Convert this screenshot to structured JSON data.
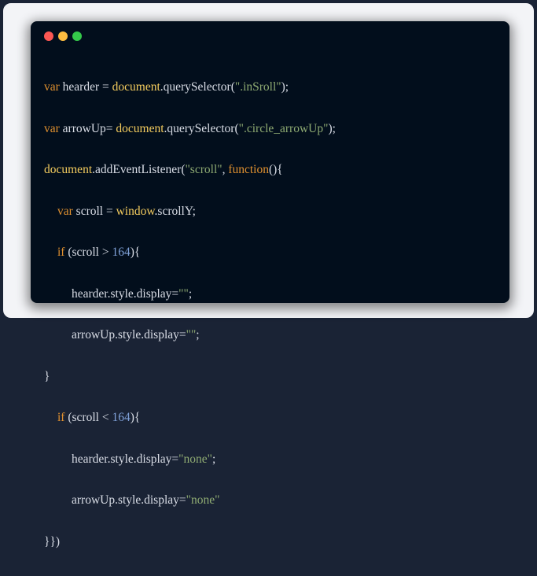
{
  "window": {
    "controls": [
      {
        "name": "close",
        "color": "#fc5753"
      },
      {
        "name": "minimize",
        "color": "#fdbc40"
      },
      {
        "name": "maximize",
        "color": "#34c84a"
      }
    ]
  },
  "colors": {
    "background": "#020e1c",
    "text": "#d9dde6",
    "keyword": "#e0902f",
    "object": "#f4cc5e",
    "string": "#8eaa72",
    "number": "#7fa1d8"
  },
  "code": {
    "line1": {
      "kw": "var",
      "a": " hearder = ",
      "obj": "document",
      "b": ".querySelector(",
      "str": "\".inSroll\"",
      "c": ");"
    },
    "line2": {
      "kw": "var",
      "a": " arrowUp= ",
      "obj": "document",
      "b": ".querySelector(",
      "str": "\".circle_arrowUp\"",
      "c": ");"
    },
    "line3": {
      "obj": "document",
      "a": ".addEventListener(",
      "str": "\"scroll\"",
      "b": ", ",
      "kw": "function",
      "c": "(){"
    },
    "line4": {
      "kw": "var",
      "a": " scroll = ",
      "obj": "window",
      "b": ".scrollY;"
    },
    "line5": {
      "kw": "if",
      "a": " (scroll > ",
      "num": "164",
      "b": "){"
    },
    "line6": {
      "a": "hearder.style.display=",
      "str": "\"\"",
      "b": ";"
    },
    "line7": {
      "a": "arrowUp.style.display=",
      "str": "\"\"",
      "b": ";"
    },
    "line8": {
      "a": "}"
    },
    "line9": {
      "kw": "if",
      "a": " (scroll < ",
      "num": "164",
      "b": "){"
    },
    "line10": {
      "a": "hearder.style.display=",
      "str": "\"none\"",
      "b": ";"
    },
    "line11": {
      "a": "arrowUp.style.display=",
      "str": "\"none\""
    },
    "line12": {
      "a": "}})"
    }
  }
}
